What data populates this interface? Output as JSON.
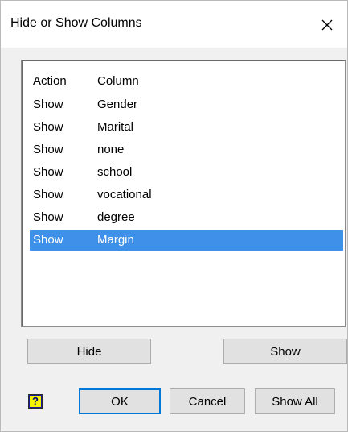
{
  "dialog": {
    "title": "Hide or Show Columns",
    "close_icon": "close-x-icon"
  },
  "list": {
    "headers": {
      "action": "Action",
      "column": "Column"
    },
    "rows": [
      {
        "action": "Show",
        "column": "Gender",
        "selected": false
      },
      {
        "action": "Show",
        "column": "Marital",
        "selected": false
      },
      {
        "action": "Show",
        "column": "none",
        "selected": false
      },
      {
        "action": "Show",
        "column": "school",
        "selected": false
      },
      {
        "action": "Show",
        "column": "vocational",
        "selected": false
      },
      {
        "action": "Show",
        "column": "degree",
        "selected": false
      },
      {
        "action": "Show",
        "column": "Margin",
        "selected": true
      }
    ]
  },
  "buttons": {
    "hide": "Hide",
    "show": "Show",
    "ok": "OK",
    "cancel": "Cancel",
    "show_all": "Show All",
    "help_glyph": "?"
  },
  "colors": {
    "selection": "#3e90e8",
    "focus_border": "#0078d7",
    "help_icon_bg": "#f5f500"
  }
}
